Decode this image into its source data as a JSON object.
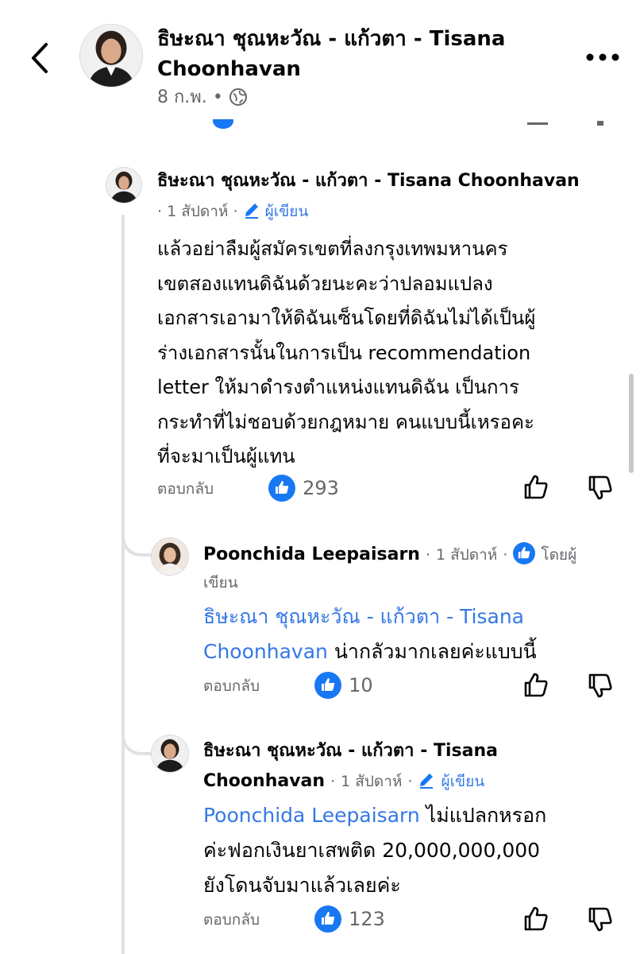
{
  "header": {
    "back_icon": "chevron-left-icon",
    "author_line1": "ธิษะณา ชุณหะวัณ - แก้วตา - Tisana",
    "author_line2": "Choonhavan",
    "date": "8 ก.พ.",
    "dot": "•",
    "privacy_icon": "globe-icon",
    "more_icon": "more-horizontal-icon"
  },
  "comments": [
    {
      "author": "ธิษะณา ชุณหะวัณ - แก้วตา - Tisana Choonhavan",
      "time": "1 สัปดาห์",
      "dot": "·",
      "author_badge": "ผู้เขียน",
      "body_lines": [
        "แล้วอย่าลืมผู้สมัครเขตที่ลงกรุงเทพมหานคร",
        "เขตสองแทนดิฉันด้วยนะคะว่าปลอมแปลง",
        "เอกสารเอามาให้ดิฉันเซ็นโดยที่ดิฉันไม่ได้เป็นผู้",
        "ร่างเอกสารนั้นในการเป็น recommendation",
        "letter ให้มาดำรงตำแหน่งแทนดิฉัน เป็นการ",
        "กระทำที่ไม่ชอบด้วยกฎหมาย คนแบบนี้เหรอคะ",
        "ที่จะมาเป็นผู้แทน"
      ],
      "reply_label": "ตอบกลับ",
      "likes": "293"
    },
    {
      "author": "Poonchida Leepaisarn",
      "time": "1 สัปดาห์",
      "dot": "·",
      "badge_label_a": "โดยผู้",
      "badge_label_b": "เขียน",
      "mention_line1": "ธิษะณา ชุณหะวัณ - แก้วตา - Tisana",
      "mention_line2": "Choonhavan",
      "body_after_mention": " น่ากลัวมากเลยค่ะแบบนี้",
      "reply_label": "ตอบกลับ",
      "likes": "10"
    },
    {
      "author_line1": "ธิษะณา ชุณหะวัณ - แก้วตา - Tisana",
      "author_line2": "Choonhavan",
      "time": "1 สัปดาห์",
      "dot": "·",
      "author_badge": "ผู้เขียน",
      "mention": "Poonchida Leepaisarn",
      "body_line1_rest": " ไม่แปลกหรอก",
      "body_line2": "ค่ะฟอกเงินยาเสพติด 20,000,000,000",
      "body_line3": "ยังโดนจับมาแล้วเลยค่ะ",
      "reply_label": "ตอบกลับ",
      "likes": "123"
    }
  ],
  "colors": {
    "link": "#3578e5",
    "meta": "#65676b",
    "like_blue": "#1877f2"
  }
}
